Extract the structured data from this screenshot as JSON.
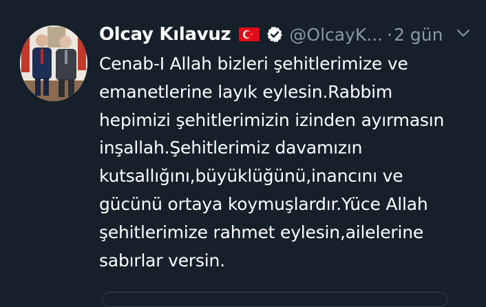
{
  "tweet": {
    "author": {
      "name": "Olcay Kılavuz",
      "handle": "@OlcayK...",
      "flag_icon": "turkey-flag-icon",
      "verified_icon": "verified-badge-icon"
    },
    "separator": "·",
    "timestamp": "2 gün",
    "menu_icon": "chevron-down-icon",
    "text_lines": [
      "Cenab-I Allah bizleri şehitlerimize ve",
      "emanetlerine layık eylesin.Rabbim",
      "hepimizi şehitlerimizin izinden ayırmasın",
      "inşallah.Şehitlerimiz davamızın",
      "kutsallığını,büyüklüğünü,inancını ve",
      "gücünü ortaya koymuşlardır.Yüce Allah",
      "şehitlerimize rahmet eylesin,ailelerine",
      "sabırlar versin."
    ]
  },
  "colors": {
    "background": "#15202b",
    "text_primary": "#ffffff",
    "text_secondary": "#8899a6",
    "flag_red": "#e30a17",
    "verified_badge": "#ffffff"
  }
}
